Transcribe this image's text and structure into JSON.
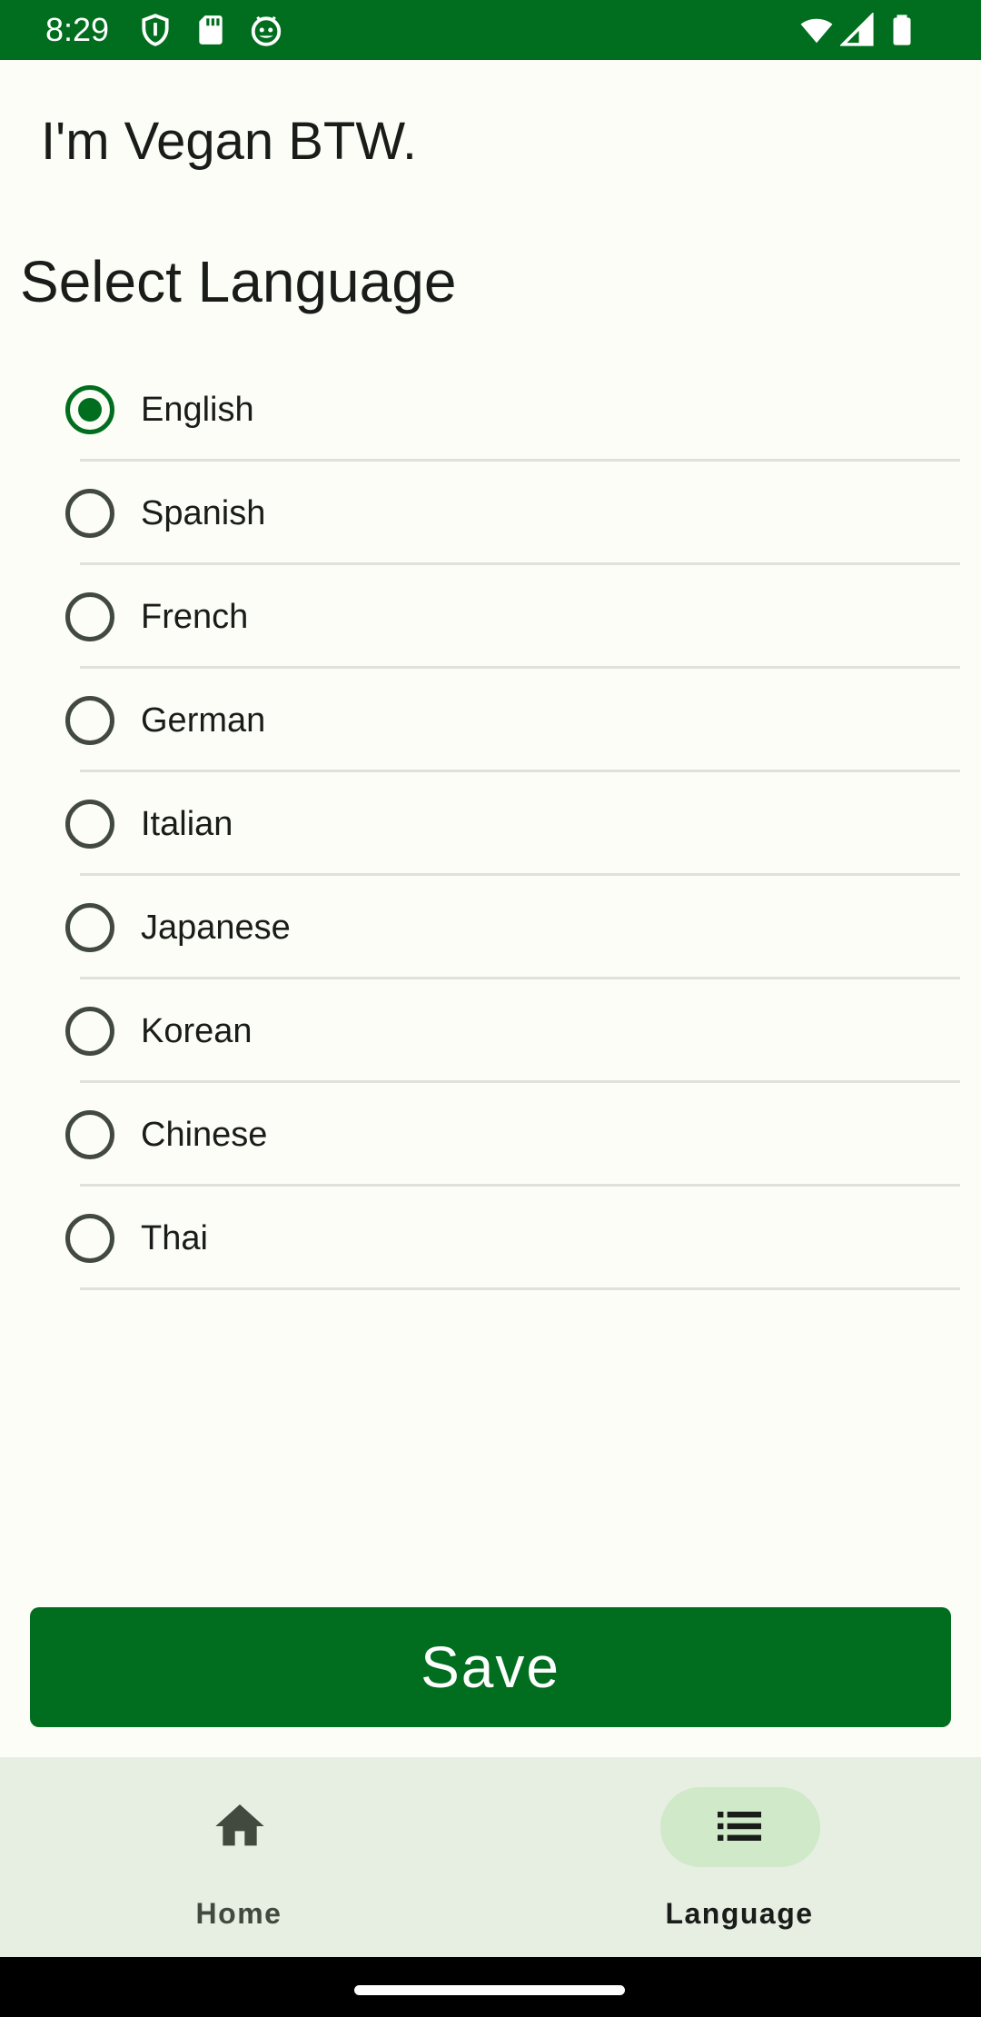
{
  "status_bar": {
    "time": "8:29",
    "icons": [
      "shield-icon",
      "sd-card-icon",
      "android-debug-icon",
      "wifi-icon",
      "signal-icon",
      "battery-icon"
    ],
    "color": "#006e1e"
  },
  "app": {
    "title": "I'm Vegan BTW."
  },
  "language_screen": {
    "title": "Select Language",
    "selected": "English",
    "options": [
      {
        "label": "English",
        "checked": true
      },
      {
        "label": "Spanish",
        "checked": false
      },
      {
        "label": "French",
        "checked": false
      },
      {
        "label": "German",
        "checked": false
      },
      {
        "label": "Italian",
        "checked": false
      },
      {
        "label": "Japanese",
        "checked": false
      },
      {
        "label": "Korean",
        "checked": false
      },
      {
        "label": "Chinese",
        "checked": false
      },
      {
        "label": "Thai",
        "checked": false
      }
    ],
    "save_label": "Save"
  },
  "bottom_nav": {
    "items": [
      {
        "label": "Home",
        "icon": "home-icon",
        "active": false
      },
      {
        "label": "Language",
        "icon": "list-icon",
        "active": true
      }
    ]
  },
  "colors": {
    "primary": "#006e1e",
    "background": "#fbfdf6",
    "nav_background": "#e6efe2",
    "nav_active_pill": "#cfe9c9"
  }
}
